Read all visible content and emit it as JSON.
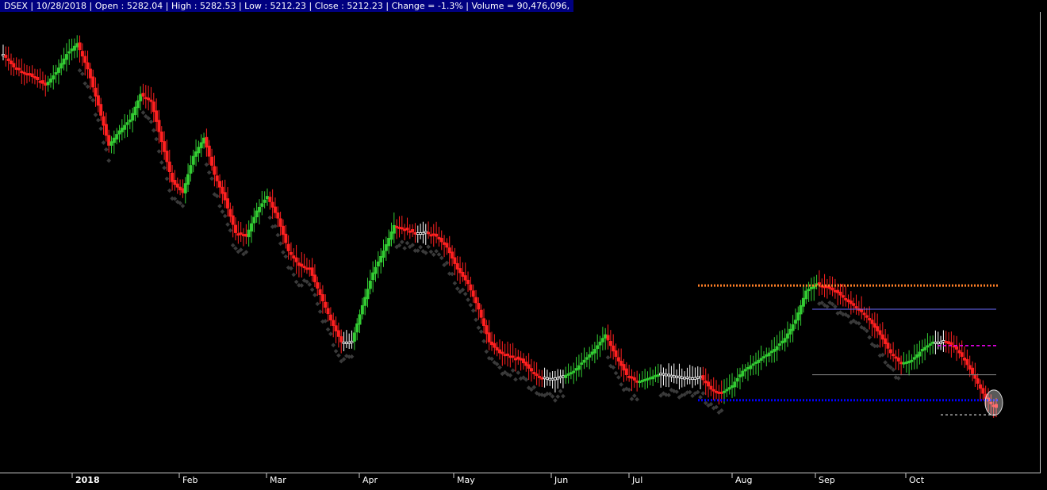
{
  "header": {
    "text": "DSEX | 10/28/2018 | Open : 5282.04 | High : 5282.53 | Low : 5212.23 | Close : 5212.23 | Change = -1.3% | Volume = 90,476,096,"
  },
  "colors": {
    "background": "#000000",
    "header_bg": "#000080",
    "up_bar": "#33cc33",
    "down_bar": "#ff2020",
    "neutral_bar": "#ffffff",
    "stop_dots": "#3a3a3a",
    "resistance": "#ff7f27",
    "support": "#0000ff",
    "fib_line": "#6c6cff",
    "magenta_line": "#ff00ff",
    "grey_line": "#808080"
  },
  "chart_data": {
    "type": "candlestick",
    "symbol": "DSEX",
    "x_axis_labels": [
      "2018",
      "Feb",
      "Mar",
      "Apr",
      "May",
      "Jun",
      "Jul",
      "Aug",
      "Sep",
      "Oct"
    ],
    "y_range": [
      5150,
      6400
    ],
    "close_path": [
      [
        0,
        6290
      ],
      [
        4,
        6255
      ],
      [
        8,
        6240
      ],
      [
        12,
        6225
      ],
      [
        16,
        6205
      ],
      [
        20,
        6240
      ],
      [
        24,
        6290
      ],
      [
        28,
        6320
      ],
      [
        32,
        6250
      ],
      [
        36,
        6150
      ],
      [
        40,
        6040
      ],
      [
        44,
        6080
      ],
      [
        48,
        6110
      ],
      [
        52,
        6180
      ],
      [
        56,
        6160
      ],
      [
        60,
        6050
      ],
      [
        64,
        5940
      ],
      [
        68,
        5910
      ],
      [
        72,
        6010
      ],
      [
        76,
        6060
      ],
      [
        80,
        5960
      ],
      [
        84,
        5890
      ],
      [
        88,
        5800
      ],
      [
        92,
        5790
      ],
      [
        96,
        5860
      ],
      [
        100,
        5900
      ],
      [
        104,
        5840
      ],
      [
        108,
        5750
      ],
      [
        112,
        5710
      ],
      [
        116,
        5700
      ],
      [
        120,
        5630
      ],
      [
        124,
        5560
      ],
      [
        128,
        5500
      ],
      [
        132,
        5500
      ],
      [
        136,
        5600
      ],
      [
        140,
        5690
      ],
      [
        144,
        5750
      ],
      [
        148,
        5820
      ],
      [
        152,
        5810
      ],
      [
        156,
        5800
      ],
      [
        160,
        5800
      ],
      [
        164,
        5790
      ],
      [
        168,
        5760
      ],
      [
        172,
        5700
      ],
      [
        176,
        5660
      ],
      [
        180,
        5590
      ],
      [
        184,
        5500
      ],
      [
        188,
        5470
      ],
      [
        192,
        5460
      ],
      [
        196,
        5450
      ],
      [
        200,
        5420
      ],
      [
        204,
        5400
      ],
      [
        208,
        5400
      ],
      [
        212,
        5405
      ],
      [
        216,
        5420
      ],
      [
        220,
        5450
      ],
      [
        224,
        5480
      ],
      [
        228,
        5520
      ],
      [
        232,
        5460
      ],
      [
        236,
        5410
      ],
      [
        240,
        5390
      ],
      [
        244,
        5400
      ],
      [
        248,
        5410
      ],
      [
        252,
        5410
      ],
      [
        256,
        5405
      ],
      [
        260,
        5400
      ],
      [
        264,
        5405
      ],
      [
        268,
        5370
      ],
      [
        272,
        5360
      ],
      [
        276,
        5380
      ],
      [
        280,
        5420
      ],
      [
        284,
        5440
      ],
      [
        288,
        5460
      ],
      [
        292,
        5480
      ],
      [
        296,
        5510
      ],
      [
        300,
        5560
      ],
      [
        304,
        5640
      ],
      [
        308,
        5660
      ],
      [
        312,
        5650
      ],
      [
        316,
        5635
      ],
      [
        320,
        5610
      ],
      [
        324,
        5590
      ],
      [
        328,
        5560
      ],
      [
        332,
        5520
      ],
      [
        336,
        5470
      ],
      [
        340,
        5440
      ],
      [
        344,
        5450
      ],
      [
        348,
        5480
      ],
      [
        352,
        5500
      ],
      [
        356,
        5500
      ],
      [
        360,
        5490
      ],
      [
        364,
        5450
      ],
      [
        368,
        5400
      ],
      [
        372,
        5345
      ],
      [
        374,
        5330
      ],
      [
        376,
        5320
      ]
    ],
    "markers": [
      {
        "name": "resistance",
        "value": 5655,
        "style": "dotted"
      },
      {
        "name": "support",
        "value": 5340,
        "style": "dotted"
      },
      {
        "name": "fib-upper",
        "value": 5590,
        "style": "solid"
      },
      {
        "name": "fib-middle",
        "value": 5490,
        "style": "dashed"
      },
      {
        "name": "fib-lower",
        "value": 5410,
        "style": "solid"
      },
      {
        "name": "close-dashed",
        "value": 5300,
        "style": "dashed"
      }
    ]
  }
}
